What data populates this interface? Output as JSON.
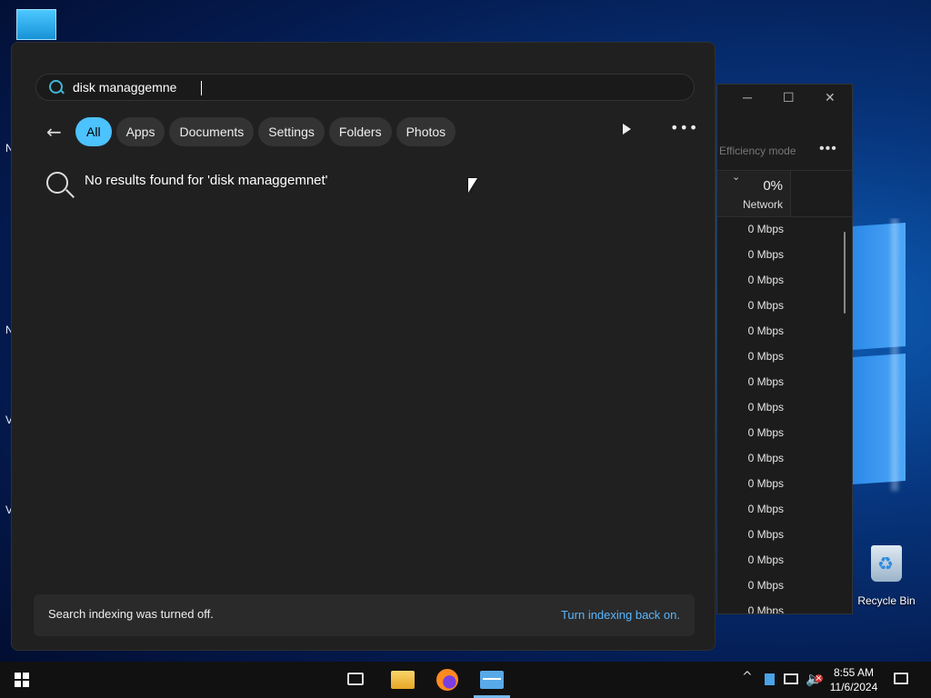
{
  "desktop": {
    "edge_letters": [
      "N",
      "V",
      "V"
    ],
    "recycle_bin_label": "Recycle Bin"
  },
  "task_manager": {
    "efficiency_mode_label": "Efficiency mode",
    "more_label": "•••",
    "network_percent": "0%",
    "network_header": "Network",
    "network_rows": [
      "0 Mbps",
      "0 Mbps",
      "0 Mbps",
      "0 Mbps",
      "0 Mbps",
      "0 Mbps",
      "0 Mbps",
      "0 Mbps",
      "0 Mbps",
      "0 Mbps",
      "0 Mbps",
      "0 Mbps",
      "0 Mbps",
      "0 Mbps",
      "0 Mbps",
      "0 Mbps"
    ]
  },
  "search": {
    "query": "disk managgemne",
    "filters": [
      "All",
      "Apps",
      "Documents",
      "Settings",
      "Folders",
      "Photos"
    ],
    "active_filter": "All",
    "more_label": "•••",
    "no_results_text": "No results found for 'disk managgemnet'",
    "indexing_message": "Search indexing was turned off.",
    "indexing_link": "Turn indexing back on."
  },
  "taskbar": {
    "time": "8:55 AM",
    "date": "11/6/2024",
    "tray_chevron": "^"
  },
  "colors": {
    "accent": "#4cc2ff",
    "link": "#59b6ff",
    "panel_bg": "#202020"
  }
}
